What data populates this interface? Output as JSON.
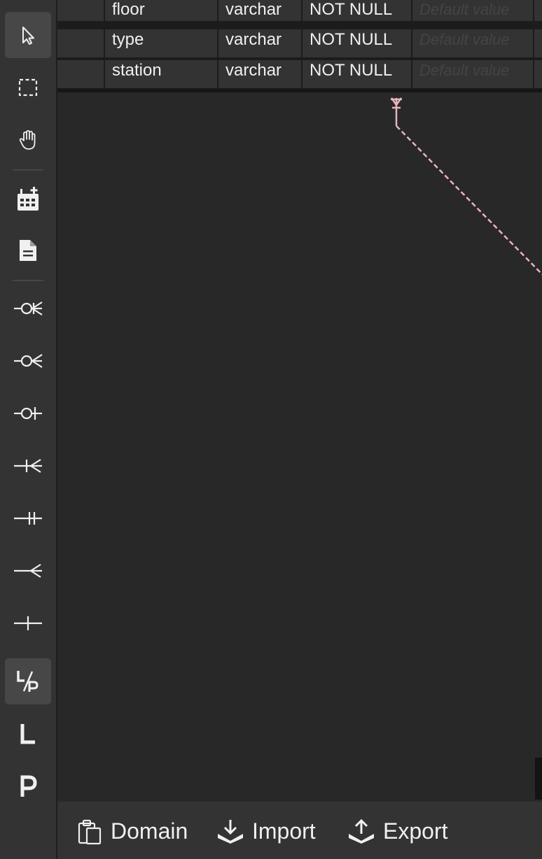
{
  "toolbar": {
    "tools": [
      {
        "name": "select-tool",
        "icon": "cursor-arrow-icon",
        "active": true
      },
      {
        "name": "marquee-tool",
        "icon": "dashed-rectangle-icon",
        "active": false
      },
      {
        "name": "pan-tool",
        "icon": "hand-icon",
        "active": false
      },
      {
        "name": "add-table-tool",
        "icon": "table-add-icon",
        "active": false
      },
      {
        "name": "add-note-tool",
        "icon": "note-icon",
        "active": false
      },
      {
        "name": "zero-or-many-relation-tool",
        "icon": "zero-or-many-icon",
        "active": false
      },
      {
        "name": "zero-or-many-non-identifying-tool",
        "icon": "zero-or-many-crow-icon",
        "active": false
      },
      {
        "name": "zero-or-one-relation-tool",
        "icon": "zero-or-one-icon",
        "active": false
      },
      {
        "name": "one-or-many-relation-tool",
        "icon": "one-or-many-icon",
        "active": false
      },
      {
        "name": "one-only-relation-tool",
        "icon": "one-only-icon",
        "active": false
      },
      {
        "name": "many-relation-tool",
        "icon": "many-crow-icon",
        "active": false
      },
      {
        "name": "one-relation-tool",
        "icon": "one-bar-icon",
        "active": false
      },
      {
        "name": "logical-physical-toggle",
        "icon": "logical-physical-icon",
        "active": true
      },
      {
        "name": "logical-view-tool",
        "icon": "letter-l-icon",
        "active": false
      },
      {
        "name": "physical-view-tool",
        "icon": "letter-p-icon",
        "active": false
      }
    ]
  },
  "table": {
    "rows": [
      {
        "name": "floor",
        "type": "varchar",
        "constraint": "NOT NULL",
        "default_placeholder": "Default value"
      },
      {
        "name": "type",
        "type": "varchar",
        "constraint": "NOT NULL",
        "default_placeholder": "Default value"
      },
      {
        "name": "station",
        "type": "varchar",
        "constraint": "NOT NULL",
        "default_placeholder": "Default value"
      }
    ]
  },
  "relation": {
    "color": "#e8b4c0",
    "style": "dashed"
  },
  "bottombar": {
    "domain_label": "Domain",
    "import_label": "Import",
    "export_label": "Export"
  },
  "colors": {
    "canvas": "#282828",
    "toolbar": "#333333",
    "cell": "#333333",
    "text": "#f0f0f0"
  }
}
